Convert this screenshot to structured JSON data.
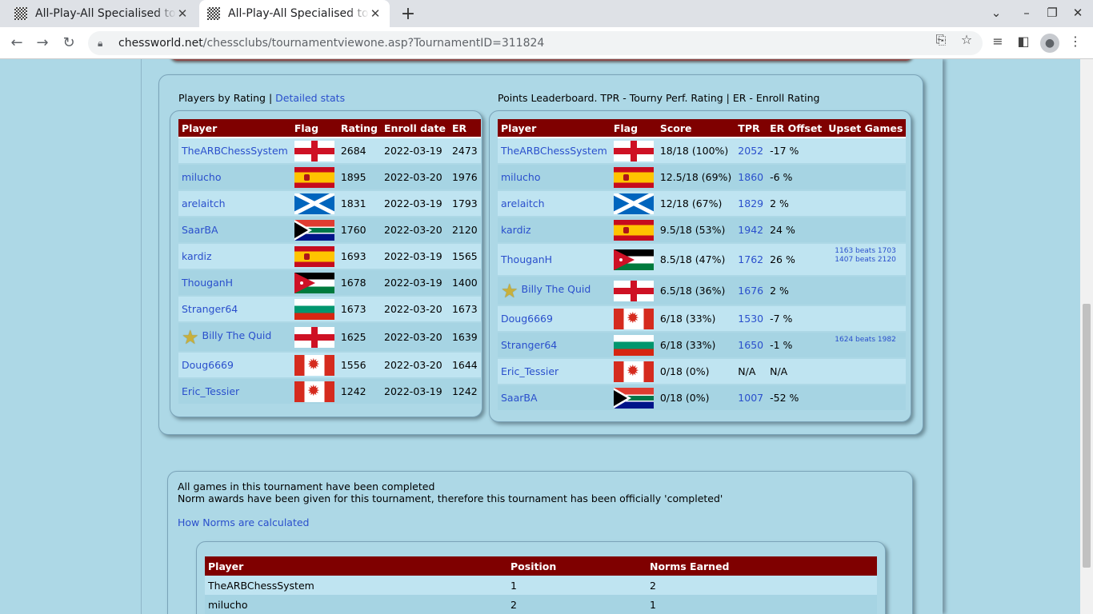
{
  "browser": {
    "tabs": [
      {
        "title": "All-Play-All Specialised tou"
      },
      {
        "title": "All-Play-All Specialised tou"
      }
    ],
    "url_host": "chessworld.net",
    "url_path": "/chessclubs/tournamentviewone.asp?TournamentID=311824"
  },
  "ratings": {
    "caption": "Players by Rating |",
    "link": "Detailed stats",
    "headers": [
      "Player",
      "Flag",
      "Rating",
      "Enroll date",
      "ER"
    ],
    "rows": [
      {
        "player": "TheARBChessSystem",
        "flag": "england",
        "rating": "2684",
        "date": "2022-03-19",
        "er": "2473",
        "star": false
      },
      {
        "player": "milucho",
        "flag": "spain",
        "rating": "1895",
        "date": "2022-03-20",
        "er": "1976",
        "star": false
      },
      {
        "player": "arelaitch",
        "flag": "scotland",
        "rating": "1831",
        "date": "2022-03-19",
        "er": "1793",
        "star": false
      },
      {
        "player": "SaarBA",
        "flag": "south-africa",
        "rating": "1760",
        "date": "2022-03-20",
        "er": "2120",
        "star": false
      },
      {
        "player": "kardiz",
        "flag": "spain",
        "rating": "1693",
        "date": "2022-03-19",
        "er": "1565",
        "star": false
      },
      {
        "player": "ThouganH",
        "flag": "jordan",
        "rating": "1678",
        "date": "2022-03-19",
        "er": "1400",
        "star": false
      },
      {
        "player": "Stranger64",
        "flag": "bulgaria",
        "rating": "1673",
        "date": "2022-03-20",
        "er": "1673",
        "star": false
      },
      {
        "player": "Billy The Quid",
        "flag": "england",
        "rating": "1625",
        "date": "2022-03-20",
        "er": "1639",
        "star": true
      },
      {
        "player": "Doug6669",
        "flag": "canada",
        "rating": "1556",
        "date": "2022-03-20",
        "er": "1644",
        "star": false
      },
      {
        "player": "Eric_Tessier",
        "flag": "canada",
        "rating": "1242",
        "date": "2022-03-19",
        "er": "1242",
        "star": false
      }
    ]
  },
  "leaderboard": {
    "caption": "Points Leaderboard. TPR - Tourny Perf. Rating | ER - Enroll Rating",
    "headers": [
      "Player",
      "Flag",
      "Score",
      "TPR",
      "ER Offset",
      "Upset Games"
    ],
    "rows": [
      {
        "player": "TheARBChessSystem",
        "flag": "england",
        "score": "18/18 (100%)",
        "tpr": "2052",
        "tpr_link": true,
        "offset": "-17 %",
        "upsets": [],
        "star": false
      },
      {
        "player": "milucho",
        "flag": "spain",
        "score": "12.5/18 (69%)",
        "tpr": "1860",
        "tpr_link": true,
        "offset": "-6 %",
        "upsets": [],
        "star": false
      },
      {
        "player": "arelaitch",
        "flag": "scotland",
        "score": "12/18 (67%)",
        "tpr": "1829",
        "tpr_link": true,
        "offset": "2 %",
        "upsets": [],
        "star": false
      },
      {
        "player": "kardiz",
        "flag": "spain",
        "score": "9.5/18 (53%)",
        "tpr": "1942",
        "tpr_link": true,
        "offset": "24 %",
        "upsets": [],
        "star": false
      },
      {
        "player": "ThouganH",
        "flag": "jordan",
        "score": "8.5/18 (47%)",
        "tpr": "1762",
        "tpr_link": true,
        "offset": "26 %",
        "upsets": [
          "1163 beats 1703",
          "1407 beats 2120"
        ],
        "star": false
      },
      {
        "player": "Billy The Quid",
        "flag": "england",
        "score": "6.5/18 (36%)",
        "tpr": "1676",
        "tpr_link": true,
        "offset": "2 %",
        "upsets": [],
        "star": true
      },
      {
        "player": "Doug6669",
        "flag": "canada",
        "score": "6/18 (33%)",
        "tpr": "1530",
        "tpr_link": true,
        "offset": "-7 %",
        "upsets": [],
        "star": false
      },
      {
        "player": "Stranger64",
        "flag": "bulgaria",
        "score": "6/18 (33%)",
        "tpr": "1650",
        "tpr_link": true,
        "offset": "-1 %",
        "upsets": [
          "1624 beats 1982"
        ],
        "star": false
      },
      {
        "player": "Eric_Tessier",
        "flag": "canada",
        "score": "0/18 (0%)",
        "tpr": "N/A",
        "tpr_link": false,
        "offset": "N/A",
        "upsets": [],
        "star": false
      },
      {
        "player": "SaarBA",
        "flag": "south-africa",
        "score": "0/18 (0%)",
        "tpr": "1007",
        "tpr_link": true,
        "offset": "-52 %",
        "upsets": [],
        "star": false
      }
    ]
  },
  "completion": {
    "line1": "All games in this tournament have been completed",
    "line2": "Norm awards have been given for this tournament, therefore this tournament has been officially 'completed'",
    "link": "How Norms are calculated"
  },
  "norms": {
    "headers": [
      "Player",
      "Position",
      "Norms Earned"
    ],
    "rows": [
      {
        "player": "TheARBChessSystem",
        "position": "1",
        "norms": "2"
      },
      {
        "player": "milucho",
        "position": "2",
        "norms": "1"
      }
    ]
  },
  "colors": {
    "header_bg": "#7f0000",
    "page_bg": "#add8e6",
    "link": "#2a4fcc"
  }
}
